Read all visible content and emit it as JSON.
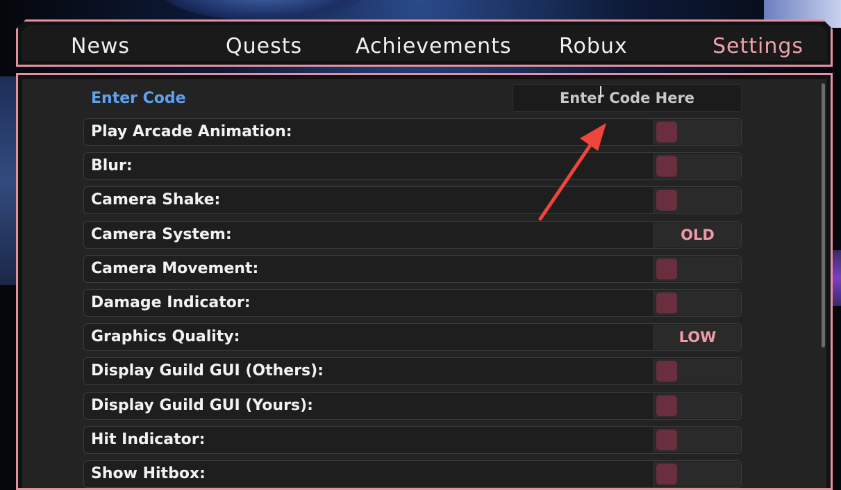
{
  "tabs": [
    {
      "label": "News",
      "active": false
    },
    {
      "label": "Quests",
      "active": false
    },
    {
      "label": "Achievements",
      "active": false
    },
    {
      "label": "Robux",
      "active": false
    },
    {
      "label": "Settings",
      "active": true
    }
  ],
  "code": {
    "label": "Enter Code",
    "placeholder": "Enter Code Here"
  },
  "settings": [
    {
      "label": "Play Arcade Animation:",
      "type": "toggle",
      "on": false
    },
    {
      "label": "Blur:",
      "type": "toggle",
      "on": false
    },
    {
      "label": "Camera Shake:",
      "type": "toggle",
      "on": false
    },
    {
      "label": "Camera System:",
      "type": "choice",
      "value": "OLD"
    },
    {
      "label": "Camera Movement:",
      "type": "toggle",
      "on": false
    },
    {
      "label": "Damage Indicator:",
      "type": "toggle",
      "on": false
    },
    {
      "label": "Graphics Quality:",
      "type": "choice",
      "value": "LOW"
    },
    {
      "label": "Display Guild GUI (Others):",
      "type": "toggle",
      "on": false
    },
    {
      "label": "Display Guild GUI (Yours):",
      "type": "toggle",
      "on": false
    },
    {
      "label": "Hit Indicator:",
      "type": "toggle",
      "on": false
    },
    {
      "label": "Show Hitbox:",
      "type": "toggle",
      "on": false
    }
  ],
  "colors": {
    "accent_border": "#e8909e",
    "active_tab": "#f0a0ae",
    "code_label": "#5ea1f0",
    "toggle_knob": "#6a2f3e",
    "annotation_arrow": "#f0453a"
  }
}
